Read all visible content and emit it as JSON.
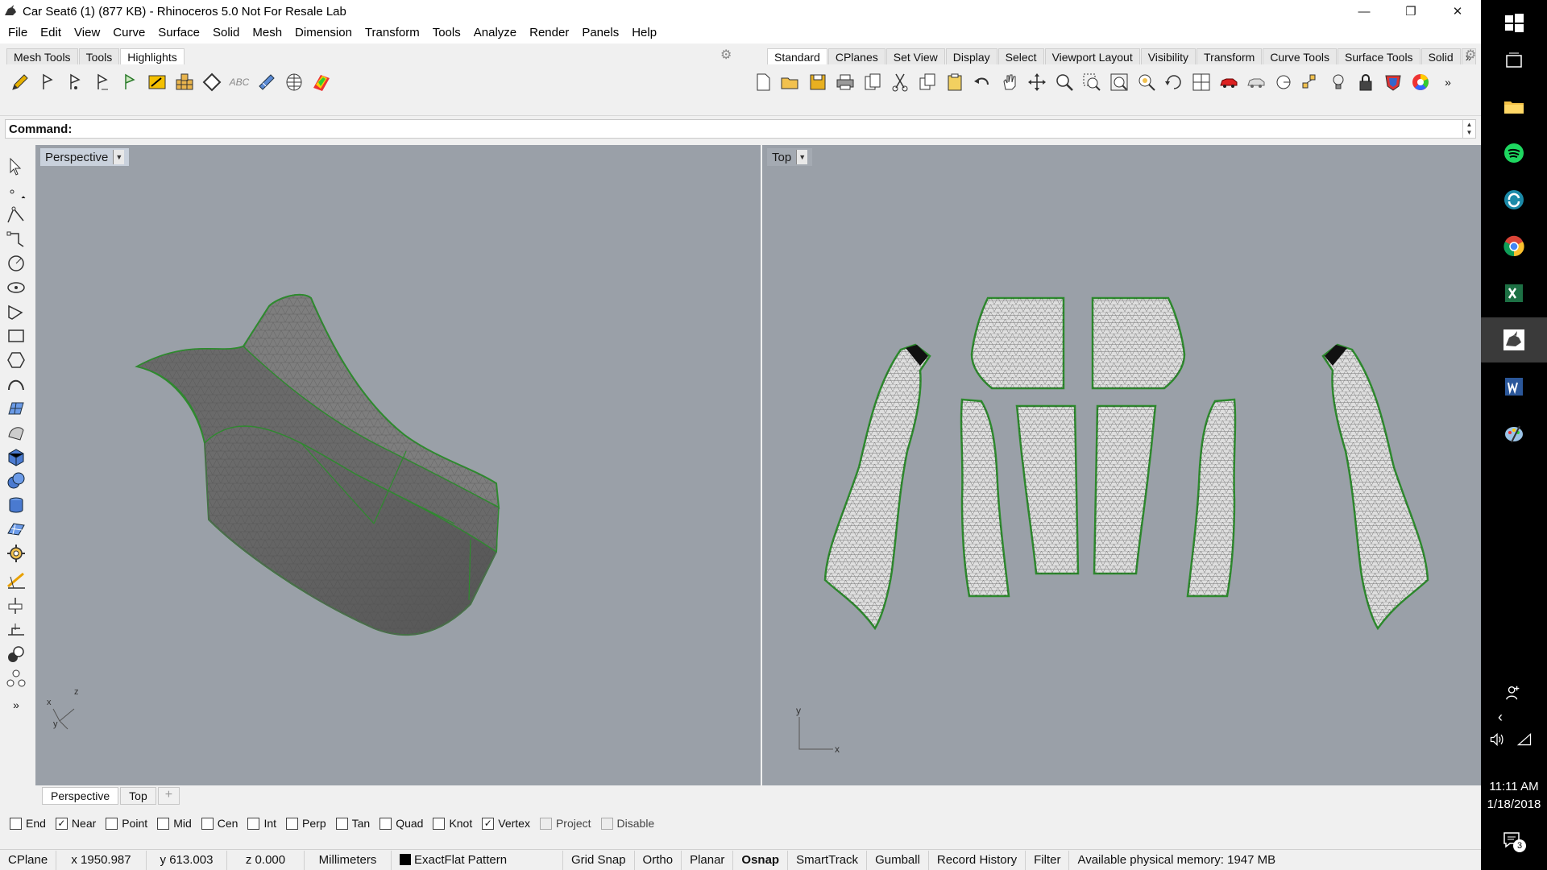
{
  "window": {
    "title": "Car Seat6 (1) (877 KB) - Rhinoceros 5.0 Not For Resale Lab",
    "minimize": "—",
    "restore": "❐",
    "close": "✕"
  },
  "menu": [
    "File",
    "Edit",
    "View",
    "Curve",
    "Surface",
    "Solid",
    "Mesh",
    "Dimension",
    "Transform",
    "Tools",
    "Analyze",
    "Render",
    "Panels",
    "Help"
  ],
  "left_toolbar_tabs": [
    {
      "label": "Mesh Tools",
      "active": false
    },
    {
      "label": "Tools",
      "active": false
    },
    {
      "label": "Highlights",
      "active": true
    }
  ],
  "left_toolbar_icons": [
    "pencil-icon",
    "flag-icon-1",
    "flag-icon-2",
    "flag-icon-3",
    "flag-icon-4",
    "image-frame-icon",
    "building-grid-icon",
    "diamond-icon",
    "abc-text-icon",
    "stamp-icon",
    "globe-grid-icon",
    "rainbow-icon"
  ],
  "abc_text": "ABC",
  "right_toolbar_tabs": [
    {
      "label": "Standard",
      "active": true
    },
    {
      "label": "CPlanes",
      "active": false
    },
    {
      "label": "Set View",
      "active": false
    },
    {
      "label": "Display",
      "active": false
    },
    {
      "label": "Select",
      "active": false
    },
    {
      "label": "Viewport Layout",
      "active": false
    },
    {
      "label": "Visibility",
      "active": false
    },
    {
      "label": "Transform",
      "active": false
    },
    {
      "label": "Curve Tools",
      "active": false
    },
    {
      "label": "Surface Tools",
      "active": false
    },
    {
      "label": "Solid",
      "active": false
    }
  ],
  "right_toolbar_more": "»",
  "command": {
    "label": "Command:",
    "value": ""
  },
  "viewports": {
    "perspective": {
      "title": "Perspective",
      "axis": [
        "x",
        "y",
        "z"
      ]
    },
    "top": {
      "title": "Top",
      "axis": [
        "x",
        "y"
      ]
    }
  },
  "viewport_tabs": [
    {
      "label": "Perspective",
      "active": true
    },
    {
      "label": "Top",
      "active": false
    }
  ],
  "viewport_tab_add": "+",
  "left_more": "»",
  "osnaps": [
    {
      "label": "End",
      "checked": false,
      "enabled": true
    },
    {
      "label": "Near",
      "checked": true,
      "enabled": true
    },
    {
      "label": "Point",
      "checked": false,
      "enabled": true
    },
    {
      "label": "Mid",
      "checked": false,
      "enabled": true
    },
    {
      "label": "Cen",
      "checked": false,
      "enabled": true
    },
    {
      "label": "Int",
      "checked": false,
      "enabled": true
    },
    {
      "label": "Perp",
      "checked": false,
      "enabled": true
    },
    {
      "label": "Tan",
      "checked": false,
      "enabled": true
    },
    {
      "label": "Quad",
      "checked": false,
      "enabled": true
    },
    {
      "label": "Knot",
      "checked": false,
      "enabled": true
    },
    {
      "label": "Vertex",
      "checked": true,
      "enabled": true
    },
    {
      "label": "Project",
      "checked": false,
      "enabled": false
    },
    {
      "label": "Disable",
      "checked": false,
      "enabled": false
    }
  ],
  "status": {
    "cplane": "CPlane",
    "x": "x 1950.987",
    "y": "y 613.003",
    "z": "z 0.000",
    "units": "Millimeters",
    "layer": "ExactFlat Pattern",
    "grid_snap": "Grid Snap",
    "ortho": "Ortho",
    "planar": "Planar",
    "osnap": "Osnap",
    "smarttrack": "SmartTrack",
    "gumball": "Gumball",
    "record_history": "Record History",
    "filter": "Filter",
    "memory": "Available physical memory: 1947 MB"
  },
  "taskbar": {
    "time": "11:11 AM",
    "date": "1/18/2018",
    "notification_count": "3"
  },
  "colors": {
    "viewport_bg": "#9aa0a8",
    "mesh_edge": "#2e8b2e",
    "mesh_fill": "#dcdcdc",
    "shaded_mesh": "#6e6e6e"
  }
}
